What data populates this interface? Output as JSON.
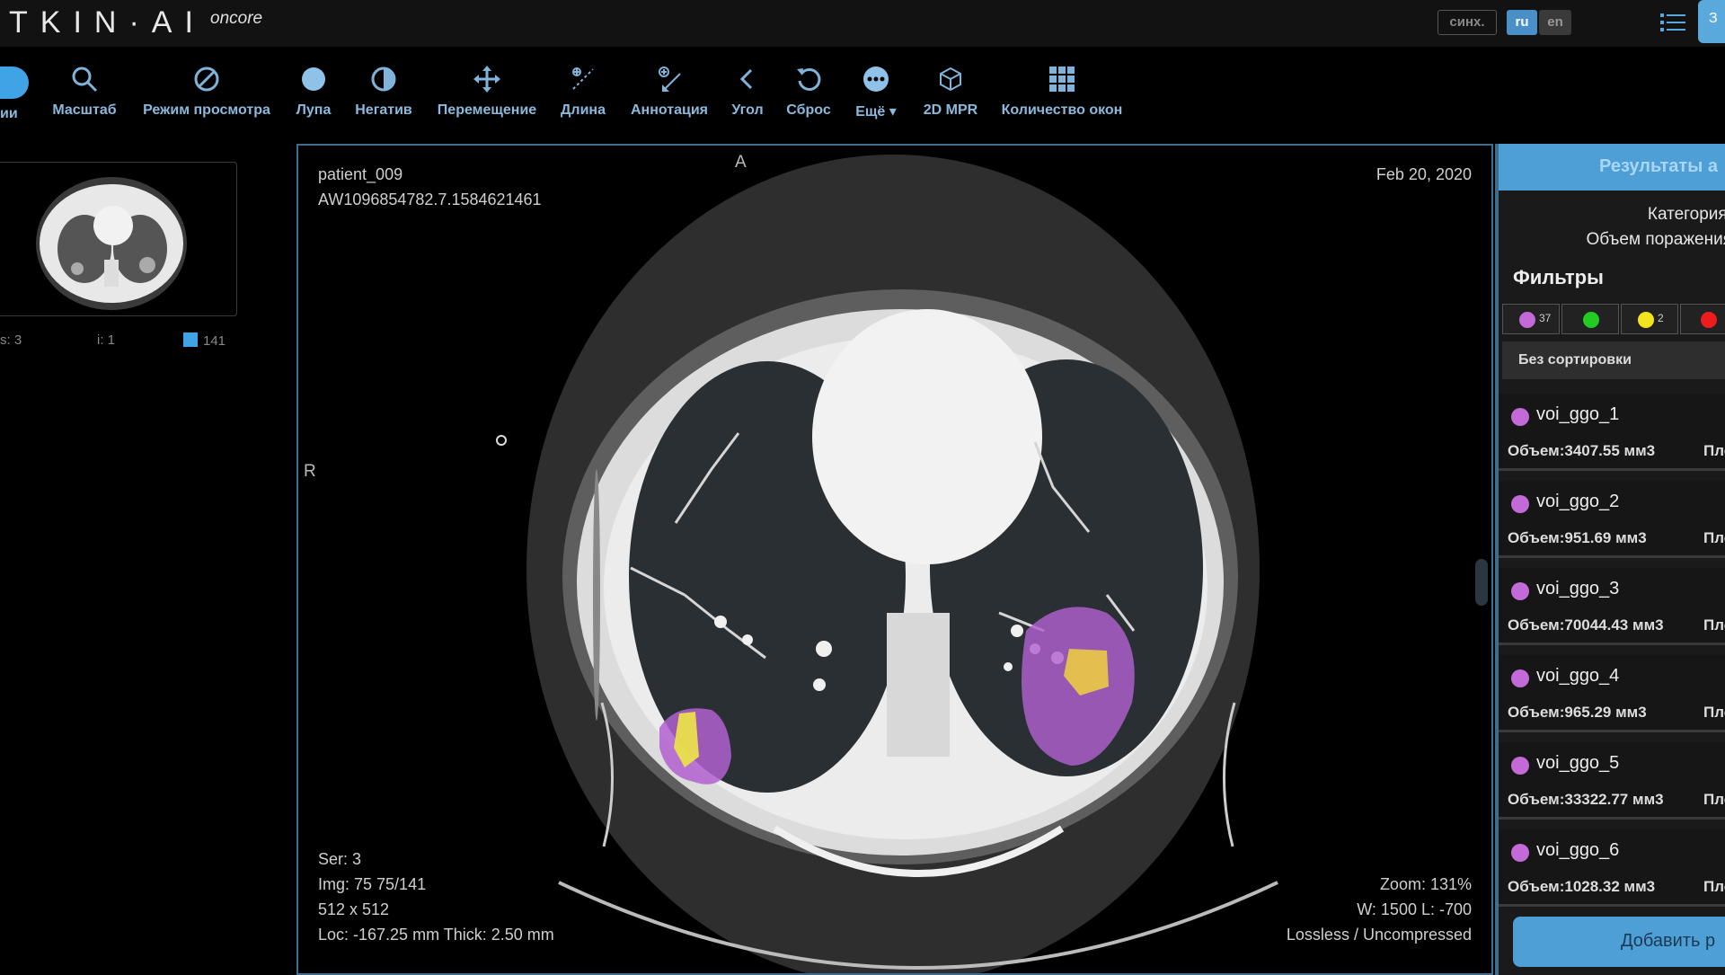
{
  "app": {
    "brand": "TKIN·AI",
    "brand_sub": "oncore",
    "sync_label": "синх.",
    "lang_ru": "ru",
    "lang_en": "en",
    "edge_button": "З"
  },
  "toolbar": {
    "edge_label": "ии",
    "tools": [
      {
        "label": "Масштаб",
        "icon": "zoom-icon"
      },
      {
        "label": "Режим просмотра",
        "icon": "view-mode-icon"
      },
      {
        "label": "Лупа",
        "icon": "magnifier-icon"
      },
      {
        "label": "Негатив",
        "icon": "invert-icon"
      },
      {
        "label": "Перемещение",
        "icon": "move-icon"
      },
      {
        "label": "Длина",
        "icon": "length-icon"
      },
      {
        "label": "Аннотация",
        "icon": "annotation-icon"
      },
      {
        "label": "Угол",
        "icon": "angle-icon"
      },
      {
        "label": "Сброс",
        "icon": "reset-icon"
      },
      {
        "label": "Ещё",
        "icon": "more-icon"
      },
      {
        "label": "2D MPR",
        "icon": "cube-icon"
      },
      {
        "label": "Количество окон",
        "icon": "grid-icon"
      }
    ]
  },
  "series_panel": {
    "series_label": "s: 3",
    "instance_label": "i: 1",
    "image_count": "141"
  },
  "viewer": {
    "patient_name": "patient_009",
    "study_id": "AW1096854782.7.1584621461",
    "date": "Feb 20, 2020",
    "orientation_top": "A",
    "orientation_left": "R",
    "ser": "Ser: 3",
    "img": "Img: 75 75/141",
    "matrix": "512 x 512",
    "loc": "Loc: -167.25 mm Thick: 2.50 mm",
    "zoom": "Zoom: 131%",
    "window": "W: 1500 L: -700",
    "compression": "Lossless / Uncompressed"
  },
  "results": {
    "header": "Результаты а",
    "category": "Категория:",
    "lesion_volume": "Объем поражения",
    "filters_title": "Фильтры",
    "filters": [
      {
        "color": "#c46ad8",
        "count": "37"
      },
      {
        "color": "#22cc22",
        "count": ""
      },
      {
        "color": "#f2e51d",
        "count": "2"
      },
      {
        "color": "#ee1c1c",
        "count": ""
      }
    ],
    "sort_label": "Без сортировки",
    "cut_label": "Пло",
    "items": [
      {
        "name": "voi_ggo_1",
        "volume": "Объем:3407.55 мм3"
      },
      {
        "name": "voi_ggo_2",
        "volume": "Объем:951.69 мм3"
      },
      {
        "name": "voi_ggo_3",
        "volume": "Объем:70044.43 мм3"
      },
      {
        "name": "voi_ggo_4",
        "volume": "Объем:965.29 мм3"
      },
      {
        "name": "voi_ggo_5",
        "volume": "Объем:33322.77 мм3"
      },
      {
        "name": "voi_ggo_6",
        "volume": "Объем:1028.32 мм3"
      }
    ],
    "add_button": "Добавить р"
  }
}
